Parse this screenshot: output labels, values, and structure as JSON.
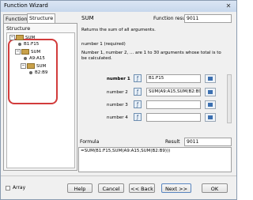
{
  "window": {
    "title": "Function Wizard",
    "close": "✕"
  },
  "tabs": [
    "Functions",
    "Structure"
  ],
  "structure": {
    "header": "Structure",
    "nodes": [
      "SUM",
      "B1:F15",
      "SUM",
      "A9:A15",
      "SUM",
      "B2:B9"
    ]
  },
  "right": {
    "function_name": "SUM",
    "function_result_label": "Function result",
    "function_result_value": "9011",
    "description": "Returns the sum of all arguments.",
    "arg_title": "number 1 (required)",
    "arg_desc": "Number 1, number 2, ... are 1 to 30 arguments whose total is to be calculated.",
    "args": [
      {
        "label": "number 1",
        "value": "B1:F15"
      },
      {
        "label": "number 2",
        "value": "SUM(A9:A15,SUM(B2:B9))"
      },
      {
        "label": "number 3",
        "value": ""
      },
      {
        "label": "number 4",
        "value": ""
      }
    ]
  },
  "formula": {
    "label": "Formula",
    "result_label": "Result",
    "result_value": "9011",
    "text": "=SUM(B1:F15,SUM(A9:A15,SUM(B2:B9)))"
  },
  "bottom": {
    "array_label": "Array",
    "help": "Help",
    "cancel": "Cancel",
    "back": "<< Back",
    "next": "Next >>",
    "ok": "OK"
  }
}
